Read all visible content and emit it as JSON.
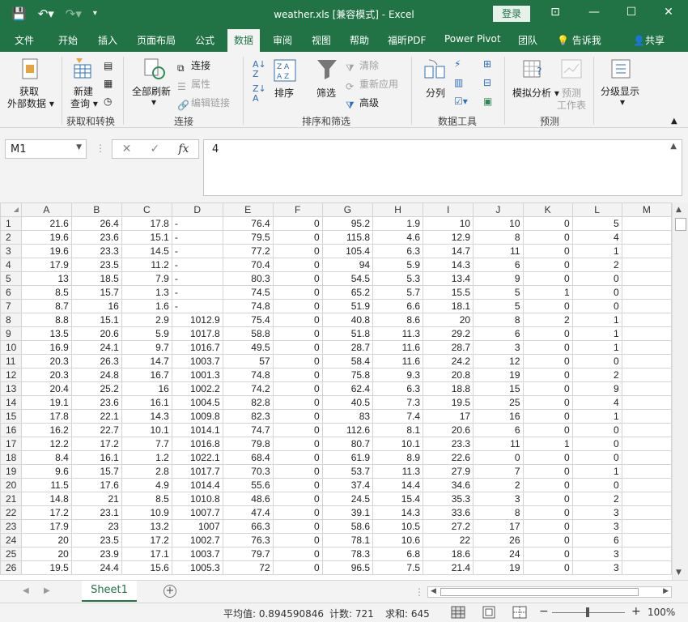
{
  "window": {
    "title": "weather.xls  [兼容模式]  -  Excel",
    "login": "登录"
  },
  "tabs": [
    "文件",
    "开始",
    "插入",
    "页面布局",
    "公式",
    "数据",
    "审阅",
    "视图",
    "帮助",
    "福昕PDF",
    "Power Pivot",
    "团队",
    "告诉我",
    "共享"
  ],
  "active_tab": "数据",
  "ribbon": {
    "get_external_line1": "获取",
    "get_external_line2": "外部数据",
    "new_query_line1": "新建",
    "new_query_line2": "查询",
    "group_get_transform": "获取和转换",
    "refresh_all": "全部刷新",
    "connections": "连接",
    "properties": "属性",
    "edit_links": "编辑链接",
    "group_connections": "连接",
    "sort": "排序",
    "filter": "筛选",
    "clear": "清除",
    "reapply": "重新应用",
    "advanced": "高级",
    "group_sort_filter": "排序和筛选",
    "text_to_columns": "分列",
    "group_data_tools": "数据工具",
    "what_if": "模拟分析",
    "forecast_line1": "预测",
    "forecast_line2": "工作表",
    "group_forecast": "预测",
    "outline": "分级显示"
  },
  "formula_bar": {
    "name_box": "M1",
    "fx": "fx",
    "value": "4"
  },
  "columns": [
    "A",
    "B",
    "C",
    "D",
    "E",
    "F",
    "G",
    "H",
    "I",
    "J",
    "K",
    "L",
    "M"
  ],
  "rows": [
    [
      "21.6",
      "26.4",
      "17.8",
      "-",
      "76.4",
      "0",
      "95.2",
      "1.9",
      "10",
      "10",
      "0",
      "5"
    ],
    [
      "19.6",
      "23.6",
      "15.1",
      "-",
      "79.5",
      "0",
      "115.8",
      "4.6",
      "12.9",
      "8",
      "0",
      "4"
    ],
    [
      "19.6",
      "23.3",
      "14.5",
      "-",
      "77.2",
      "0",
      "105.4",
      "6.3",
      "14.7",
      "11",
      "0",
      "1"
    ],
    [
      "17.9",
      "23.5",
      "11.2",
      "-",
      "70.4",
      "0",
      "94",
      "5.9",
      "14.3",
      "6",
      "0",
      "2"
    ],
    [
      "13",
      "18.5",
      "7.9",
      "-",
      "80.3",
      "0",
      "54.5",
      "5.3",
      "13.4",
      "9",
      "0",
      "0"
    ],
    [
      "8.5",
      "15.7",
      "1.3",
      "-",
      "74.5",
      "0",
      "65.2",
      "5.7",
      "15.5",
      "5",
      "1",
      "0"
    ],
    [
      "8.7",
      "16",
      "1.6",
      "-",
      "74.8",
      "0",
      "51.9",
      "6.6",
      "18.1",
      "5",
      "0",
      "0"
    ],
    [
      "8.8",
      "15.1",
      "2.9",
      "1012.9",
      "75.4",
      "0",
      "40.8",
      "8.6",
      "20",
      "8",
      "2",
      "1"
    ],
    [
      "13.5",
      "20.6",
      "5.9",
      "1017.8",
      "58.8",
      "0",
      "51.8",
      "11.3",
      "29.2",
      "6",
      "0",
      "1"
    ],
    [
      "16.9",
      "24.1",
      "9.7",
      "1016.7",
      "49.5",
      "0",
      "28.7",
      "11.6",
      "28.7",
      "3",
      "0",
      "1"
    ],
    [
      "20.3",
      "26.3",
      "14.7",
      "1003.7",
      "57",
      "0",
      "58.4",
      "11.6",
      "24.2",
      "12",
      "0",
      "0"
    ],
    [
      "20.3",
      "24.8",
      "16.7",
      "1001.3",
      "74.8",
      "0",
      "75.8",
      "9.3",
      "20.8",
      "19",
      "0",
      "2"
    ],
    [
      "20.4",
      "25.2",
      "16",
      "1002.2",
      "74.2",
      "0",
      "62.4",
      "6.3",
      "18.8",
      "15",
      "0",
      "9"
    ],
    [
      "19.1",
      "23.6",
      "16.1",
      "1004.5",
      "82.8",
      "0",
      "40.5",
      "7.3",
      "19.5",
      "25",
      "0",
      "4"
    ],
    [
      "17.8",
      "22.1",
      "14.3",
      "1009.8",
      "82.3",
      "0",
      "83",
      "7.4",
      "17",
      "16",
      "0",
      "1"
    ],
    [
      "16.2",
      "22.7",
      "10.1",
      "1014.1",
      "74.7",
      "0",
      "112.6",
      "8.1",
      "20.6",
      "6",
      "0",
      "0"
    ],
    [
      "12.2",
      "17.2",
      "7.7",
      "1016.8",
      "79.8",
      "0",
      "80.7",
      "10.1",
      "23.3",
      "11",
      "1",
      "0"
    ],
    [
      "8.4",
      "16.1",
      "1.2",
      "1022.1",
      "68.4",
      "0",
      "61.9",
      "8.9",
      "22.6",
      "0",
      "0",
      "0"
    ],
    [
      "9.6",
      "15.7",
      "2.8",
      "1017.7",
      "70.3",
      "0",
      "53.7",
      "11.3",
      "27.9",
      "7",
      "0",
      "1"
    ],
    [
      "11.5",
      "17.6",
      "4.9",
      "1014.4",
      "55.6",
      "0",
      "37.4",
      "14.4",
      "34.6",
      "2",
      "0",
      "0"
    ],
    [
      "14.8",
      "21",
      "8.5",
      "1010.8",
      "48.6",
      "0",
      "24.5",
      "15.4",
      "35.3",
      "3",
      "0",
      "2"
    ],
    [
      "17.2",
      "23.1",
      "10.9",
      "1007.7",
      "47.4",
      "0",
      "39.1",
      "14.3",
      "33.6",
      "8",
      "0",
      "3"
    ],
    [
      "17.9",
      "23",
      "13.2",
      "1007",
      "66.3",
      "0",
      "58.6",
      "10.5",
      "27.2",
      "17",
      "0",
      "3"
    ],
    [
      "20",
      "23.5",
      "17.2",
      "1002.7",
      "76.3",
      "0",
      "78.1",
      "10.6",
      "22",
      "26",
      "0",
      "6"
    ],
    [
      "20",
      "23.9",
      "17.1",
      "1003.7",
      "79.7",
      "0",
      "78.3",
      "6.8",
      "18.6",
      "24",
      "0",
      "3"
    ],
    [
      "19.5",
      "24.4",
      "15.6",
      "1005.3",
      "72",
      "0",
      "96.5",
      "7.5",
      "21.4",
      "19",
      "0",
      "3"
    ]
  ],
  "sheet": {
    "name": "Sheet1",
    "add": "+"
  },
  "status": {
    "average": "平均值: 0.894590846",
    "count": "计数: 721",
    "sum": "求和: 645",
    "zoom": "100%"
  }
}
